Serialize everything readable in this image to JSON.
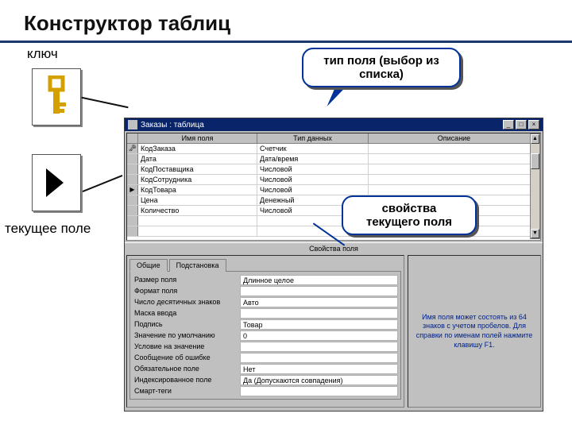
{
  "slide": {
    "title": "Конструктор таблиц",
    "label_key": "ключ",
    "label_current": "текущее поле"
  },
  "callouts": {
    "type": "тип поля (выбор из списка)",
    "props": "свойства текущего поля"
  },
  "window": {
    "title": "Заказы : таблица",
    "btn_min": "_",
    "btn_max": "□",
    "btn_close": "×",
    "headers": {
      "name": "Имя поля",
      "type": "Тип данных",
      "desc": "Описание"
    },
    "rows": [
      {
        "sel": "key",
        "name": "КодЗаказа",
        "type": "Счетчик"
      },
      {
        "sel": "",
        "name": "Дата",
        "type": "Дата/время"
      },
      {
        "sel": "",
        "name": "КодПоставщика",
        "type": "Числовой"
      },
      {
        "sel": "",
        "name": "КодСотрудника",
        "type": "Числовой"
      },
      {
        "sel": "cur",
        "name": "КодТовара",
        "type": "Числовой"
      },
      {
        "sel": "",
        "name": "Цена",
        "type": "Денежный"
      },
      {
        "sel": "",
        "name": "Количество",
        "type": "Числовой"
      }
    ],
    "midlabel": "Свойства поля",
    "tabs": {
      "general": "Общие",
      "lookup": "Подстановка"
    },
    "props": [
      {
        "label": "Размер поля",
        "value": "Длинное целое"
      },
      {
        "label": "Формат поля",
        "value": ""
      },
      {
        "label": "Число десятичных знаков",
        "value": "Авто"
      },
      {
        "label": "Маска ввода",
        "value": ""
      },
      {
        "label": "Подпись",
        "value": "Товар"
      },
      {
        "label": "Значение по умолчанию",
        "value": "0"
      },
      {
        "label": "Условие на значение",
        "value": ""
      },
      {
        "label": "Сообщение об ошибке",
        "value": ""
      },
      {
        "label": "Обязательное поле",
        "value": "Нет"
      },
      {
        "label": "Индексированное поле",
        "value": "Да (Допускаются совпадения)"
      },
      {
        "label": "Смарт-теги",
        "value": ""
      }
    ],
    "hint": "Имя поля может состоять из 64 знаков с учетом пробелов. Для справки по именам полей нажмите клавишу F1."
  }
}
